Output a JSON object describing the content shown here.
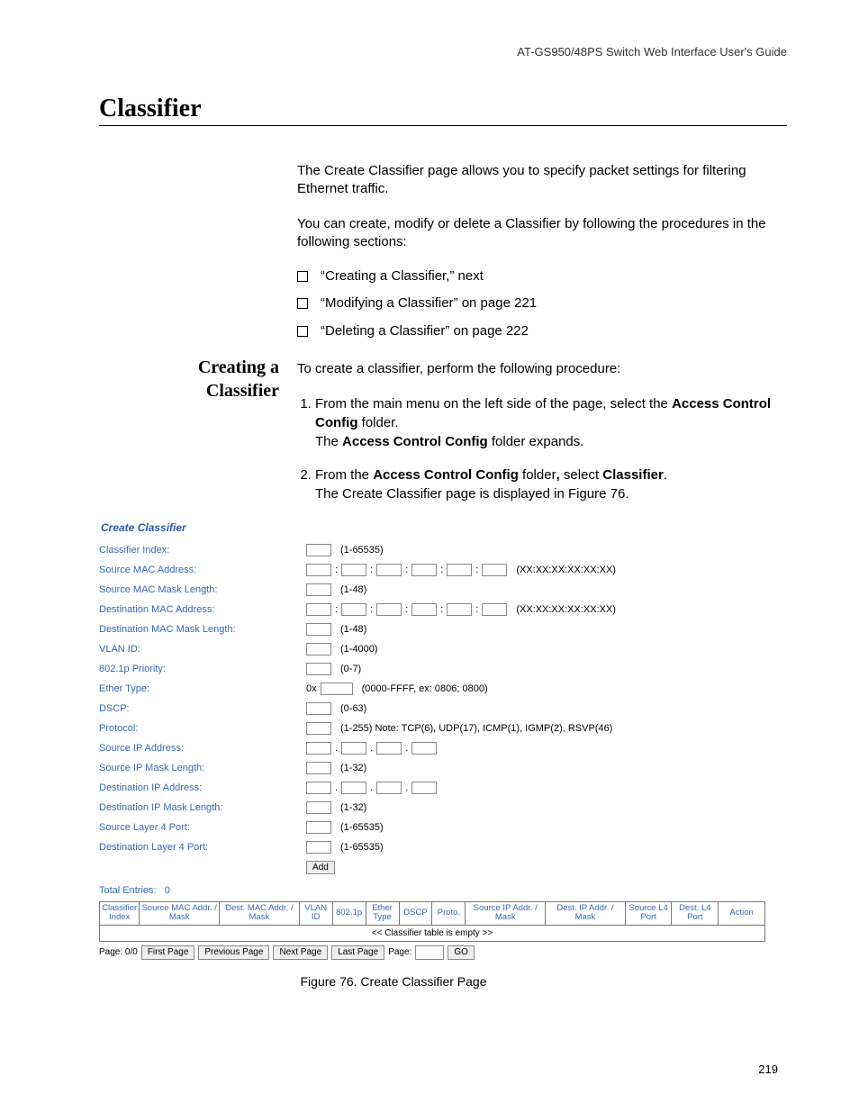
{
  "header": "AT-GS950/48PS Switch Web Interface User's Guide",
  "title": "Classifier",
  "intro1": "The Create Classifier page allows you to specify packet settings for filtering Ethernet traffic.",
  "intro2": "You can create, modify or delete a Classifier by following the procedures in the following sections:",
  "bullets": [
    "“Creating a Classifier,”  next",
    "“Modifying a Classifier” on page 221",
    "“Deleting a Classifier” on page 222"
  ],
  "sideHeading": {
    "line1": "Creating a",
    "line2": "Classifier"
  },
  "procIntro": "To create a classifier, perform the following procedure:",
  "step1": {
    "a": "From the main menu on the left side of the page, select the ",
    "b": "Access Control Config",
    "c": " folder.",
    "d": "The ",
    "e": "Access Control Config",
    "f": " folder expands."
  },
  "step2": {
    "a": "From the ",
    "b": "Access Control Config",
    "c": " folder",
    "comma": ", ",
    "d": "select ",
    "e": "Classifier",
    "f": ".",
    "g": "The Create Classifier page is displayed in Figure 76."
  },
  "ss": {
    "title": "Create Classifier",
    "rows": {
      "classifierIndex": {
        "label": "Classifier Index:",
        "hint": "(1-65535)"
      },
      "srcMac": {
        "label": "Source MAC Address:",
        "hint": "(XX:XX:XX:XX:XX:XX)"
      },
      "srcMacMask": {
        "label": "Source MAC Mask Length:",
        "hint": "(1-48)"
      },
      "dstMac": {
        "label": "Destination MAC Address:",
        "hint": "(XX:XX:XX:XX:XX:XX)"
      },
      "dstMacMask": {
        "label": "Destination MAC Mask Length:",
        "hint": "(1-48)"
      },
      "vlan": {
        "label": "VLAN ID:",
        "hint": "(1-4000)"
      },
      "pri": {
        "label": "802.1p Priority:",
        "hint": "(0-7)"
      },
      "ether": {
        "label": "Ether Type:",
        "prefix": "0x",
        "hint": "(0000-FFFF, ex: 0806; 0800)"
      },
      "dscp": {
        "label": "DSCP:",
        "hint": "(0-63)"
      },
      "proto": {
        "label": "Protocol:",
        "hint": "(1-255) Note: TCP(6), UDP(17), ICMP(1), IGMP(2), RSVP(46)"
      },
      "srcIp": {
        "label": "Source IP Address:"
      },
      "srcIpMask": {
        "label": "Source IP Mask Length:",
        "hint": "(1-32)"
      },
      "dstIp": {
        "label": "Destination IP Address:"
      },
      "dstIpMask": {
        "label": "Destination IP Mask Length:",
        "hint": "(1-32)"
      },
      "srcL4": {
        "label": "Source Layer 4 Port:",
        "hint": "(1-65535)"
      },
      "dstL4": {
        "label": "Destination Layer 4 Port:",
        "hint": "(1-65535)"
      }
    },
    "addBtn": "Add",
    "totalEntriesLabel": "Total Entries:",
    "totalEntriesValue": "0",
    "tableHeaders": [
      "Classifier Index",
      "Source MAC Addr. / Mask",
      "Dest. MAC Addr. / Mask",
      "VLAN ID",
      "802.1p",
      "Ether Type",
      "DSCP",
      "Proto.",
      "Source IP Addr. / Mask",
      "Dest. IP Addr. / Mask",
      "Source L4 Port",
      "Dest. L4 Port",
      "Action"
    ],
    "emptyMsg": "<< Classifier table is empty >>",
    "pager": {
      "page": "Page: 0/0",
      "first": "First Page",
      "prev": "Previous Page",
      "next": "Next Page",
      "last": "Last Page",
      "pageLabel": "Page:",
      "go": "GO"
    }
  },
  "figCaption": "Figure 76. Create Classifier Page",
  "pageNumber": "219"
}
